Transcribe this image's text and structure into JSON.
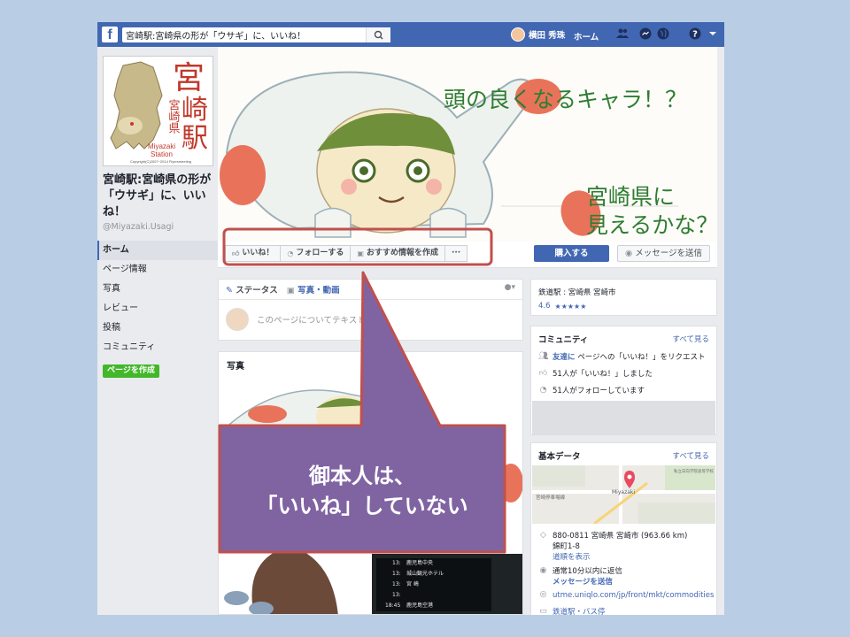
{
  "topbar": {
    "search_value": "宮崎駅:宮崎県の形が「ウサギ」に、いいね！",
    "user_name": "横田 秀珠",
    "home_label": "ホーム"
  },
  "left": {
    "page_name": "宮崎駅:宮崎県の形が「ウサギ」に、いいね！",
    "handle": "@Miyazaki.Usagi",
    "nav": [
      "ホーム",
      "ページ情報",
      "写真",
      "レビュー",
      "投稿",
      "コミュニティ"
    ],
    "create_page": "ページを作成",
    "logo": {
      "big1": "宮",
      "big2": "崎",
      "big3": "駅",
      "small": "宮崎県",
      "en1": "Miyazaki",
      "en2": "Station",
      "copy": "Copyright(C)2007~2014 Flyersmeeting"
    }
  },
  "cover": {
    "line1": "頭の良くなるキャラ！？",
    "line2": "宮崎県に",
    "line3": "見えるかな？"
  },
  "actions": {
    "like": "いいね！",
    "follow": "フォローする",
    "recommend": "おすすめ情報を作成",
    "more": "···",
    "buy": "購入する",
    "message": "メッセージを送信"
  },
  "composer": {
    "tab_status": "ステータス",
    "tab_photo": "写真・動画",
    "placeholder": "このページについてテキストを"
  },
  "photos": {
    "title": "写真",
    "station_signs": [
      "鹿児島中央",
      "城山観光ホテル",
      "宮 崎",
      "鹿児島空港"
    ],
    "station_times": [
      "13:",
      "13:",
      "13:",
      "13:",
      "18:45"
    ]
  },
  "about_card": {
    "category": "鉄道駅 : 宮崎県 宮崎市",
    "rating": "4.6"
  },
  "community": {
    "title": "コミュニティ",
    "see_all": "すべて見る",
    "invite_link": "友達に",
    "invite_rest": "ページへの「いいね！」をリクエスト",
    "likes": "51人が「いいね！」しました",
    "follows": "51人がフォローしています"
  },
  "basic_data": {
    "title": "基本データ",
    "see_all": "すべて見る",
    "map_label1": "宮崎停車場線",
    "map_label2": "Miyazaki",
    "map_label3": "私立日向学院高等学校",
    "address": "880-0811 宮崎県 宮崎市 (963.66 km)",
    "address2": "錦町1-8",
    "directions": "道順を表示",
    "response": "通常10分以内に返信",
    "send_message": "メッセージを送信",
    "url": "utme.uniqlo.com/jp/front/mkt/commodities",
    "category": "鉄道駅・バス停"
  },
  "callout": {
    "line1": "御本人は、",
    "line2": "「いいね」していない"
  },
  "colors": {
    "background": "#b9cde5",
    "fb_blue": "#4267b2",
    "callout_fill": "#8064a2",
    "callout_border": "#c0504d",
    "create_green": "#42b72a"
  }
}
